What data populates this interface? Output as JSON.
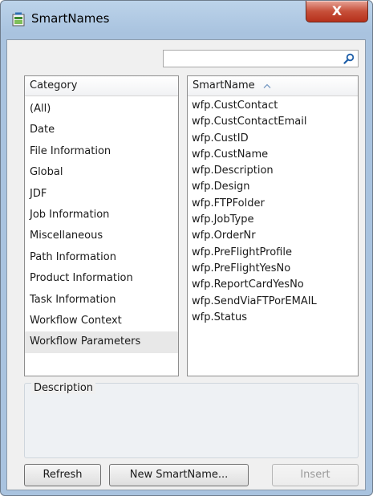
{
  "window": {
    "title": "SmartNames",
    "close_label": "X"
  },
  "search": {
    "value": "",
    "placeholder": ""
  },
  "category": {
    "header": "Category",
    "items": [
      "(All)",
      "Date",
      "File Information",
      "Global",
      "JDF",
      "Job Information",
      "Miscellaneous",
      "Path Information",
      "Product Information",
      "Task Information",
      "Workflow Context",
      "Workflow Parameters"
    ],
    "selected": "Workflow Parameters"
  },
  "smartname": {
    "header": "SmartName",
    "sort": "ascending",
    "items": [
      "wfp.CustContact",
      "wfp.CustContactEmail",
      "wfp.CustID",
      "wfp.CustName",
      "wfp.Description",
      "wfp.Design",
      "wfp.FTPFolder",
      "wfp.JobType",
      "wfp.OrderNr",
      "wfp.PreFlightProfile",
      "wfp.PreFlightYesNo",
      "wfp.ReportCardYesNo",
      "wfp.SendViaFTPorEMAIL",
      "wfp.Status"
    ]
  },
  "description": {
    "label": "Description",
    "text": ""
  },
  "buttons": {
    "refresh": "Refresh",
    "new_smartname": "New SmartName...",
    "insert": "Insert",
    "insert_enabled": false
  },
  "icons": {
    "app": "smartnames-app-icon",
    "search": "search-icon",
    "sort": "sort-ascending-icon",
    "close": "close-icon"
  },
  "colors": {
    "title_bar": "#a9c3df",
    "close_button": "#c7503a",
    "selection": "#e8e8e8"
  }
}
